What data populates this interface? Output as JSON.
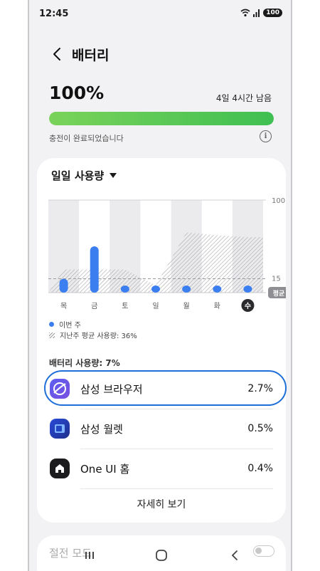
{
  "status_bar": {
    "time": "12:45",
    "battery_level": "100",
    "signal": "5G"
  },
  "header": {
    "title": "배터리"
  },
  "summary": {
    "percent_text": "100%",
    "percent_value": 1.0,
    "remaining": "4일 4시간 남음",
    "charge_status": "충전이 완료되었습니다",
    "bar_color": "#4cc552"
  },
  "usage": {
    "dropdown_label": "일일 사용량",
    "legend_this_week": "이번 주",
    "legend_last_week": "지난주 평균 사용량: 36%",
    "total_label": "배터리 사용량: 7%"
  },
  "chart_data": {
    "type": "bar",
    "categories": [
      "목",
      "금",
      "토",
      "일",
      "월",
      "화",
      "수"
    ],
    "series": [
      {
        "name": "이번 주",
        "values": [
          15,
          50,
          5,
          3,
          5,
          3,
          5
        ]
      }
    ],
    "last_week_area": [
      25,
      25,
      25,
      8,
      65,
      62,
      60
    ],
    "average_line": 15,
    "y_ticks": [
      "100",
      "15"
    ],
    "average_badge": "평균",
    "ylim": [
      0,
      100
    ],
    "selected_day": "수",
    "bar_color": "#3a7ef0"
  },
  "apps": [
    {
      "name": "삼성 브라우저",
      "percent": "2.7%",
      "icon": "samsung-internet-icon",
      "highlighted": true
    },
    {
      "name": "삼성 월렛",
      "percent": "0.5%",
      "icon": "samsung-wallet-icon",
      "highlighted": false
    },
    {
      "name": "One UI 홈",
      "percent": "0.4%",
      "icon": "home-icon",
      "highlighted": false
    }
  ],
  "details_button": "자세히 보기",
  "power_saving": {
    "label": "절전 모드"
  },
  "colors": {
    "accent": "#1e6fd9",
    "background": "#f2f2f4"
  }
}
